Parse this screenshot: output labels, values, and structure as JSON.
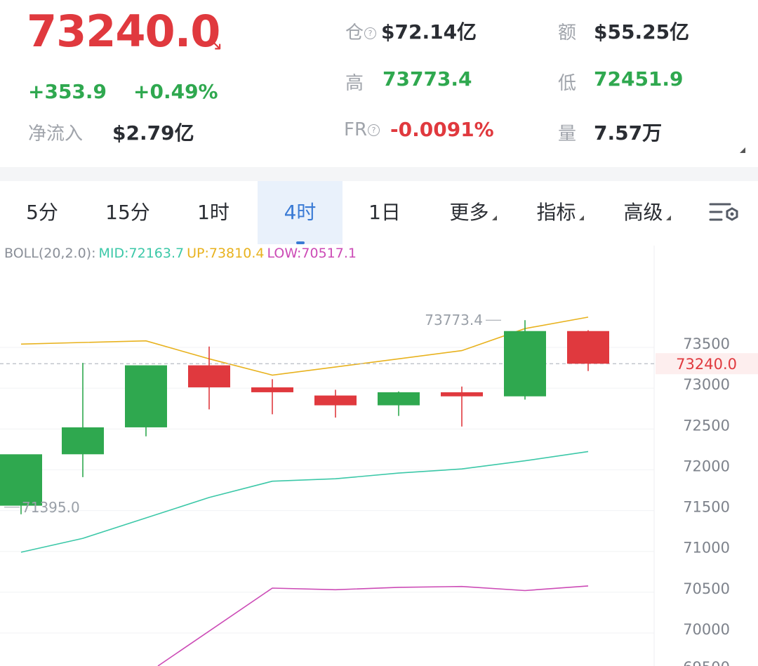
{
  "header": {
    "price": "73240.0",
    "change_abs": "+353.9",
    "change_pct": "+0.49%",
    "netflow_label": "净流入",
    "netflow_value": "$2.79亿",
    "open_interest_label": "仓",
    "open_interest_value": "$72.14亿",
    "turnover_label": "额",
    "turnover_value": "$55.25亿",
    "high_label": "高",
    "high_value": "73773.4",
    "low_label": "低",
    "low_value": "72451.9",
    "funding_label": "FR",
    "funding_value": "-0.0091%",
    "volume_label": "量",
    "volume_value": "7.57万"
  },
  "tabs": [
    {
      "label": "5分",
      "active": false
    },
    {
      "label": "15分",
      "active": false
    },
    {
      "label": "1时",
      "active": false
    },
    {
      "label": "4时",
      "active": true
    },
    {
      "label": "1日",
      "active": false
    },
    {
      "label": "更多",
      "active": false,
      "dropdown": true
    },
    {
      "label": "指标",
      "active": false,
      "dropdown": true
    },
    {
      "label": "高级",
      "active": false,
      "dropdown": true
    }
  ],
  "boll": {
    "label": "BOLL(20,2.0):",
    "mid": "MID:72163.7",
    "up": "UP:73810.4",
    "low": "LOW:70517.1"
  },
  "colors": {
    "up": "#2fa84f",
    "down": "#e0393e",
    "boll_mid": "#3cc8a8",
    "boll_up": "#e8b21e",
    "boll_low": "#cc4bb6",
    "active_tab": "#3a7bd5"
  },
  "chart_data": {
    "type": "candlestick",
    "y_ticks": [
      "73500",
      "73000",
      "72500",
      "72000",
      "71500",
      "71000",
      "70500",
      "70000"
    ],
    "ylim": [
      69900,
      74500
    ],
    "current_price_label": "73240.0",
    "high_marker": "73773.4",
    "low_marker": "71395.0",
    "candles": [
      {
        "open": 71500,
        "high": 71500,
        "low": 71395,
        "close": 72130
      },
      {
        "open": 72130,
        "high": 73250,
        "low": 71850,
        "close": 72460
      },
      {
        "open": 72460,
        "high": 73220,
        "low": 72350,
        "close": 73220
      },
      {
        "open": 73220,
        "high": 73450,
        "low": 72680,
        "close": 72950
      },
      {
        "open": 72950,
        "high": 73050,
        "low": 72620,
        "close": 72890
      },
      {
        "open": 72850,
        "high": 72920,
        "low": 72580,
        "close": 72730
      },
      {
        "open": 72730,
        "high": 72900,
        "low": 72600,
        "close": 72890
      },
      {
        "open": 72890,
        "high": 72960,
        "low": 72470,
        "close": 72840
      },
      {
        "open": 72840,
        "high": 73773.4,
        "low": 72800,
        "close": 73640
      },
      {
        "open": 73640,
        "high": 73650,
        "low": 73150,
        "close": 73240
      }
    ],
    "boll_up_series": [
      73480,
      73500,
      73520,
      73300,
      73100,
      73200,
      73300,
      73400,
      73670,
      73810.4
    ],
    "boll_mid_series": [
      70930,
      71100,
      71350,
      71600,
      71800,
      71830,
      71900,
      71950,
      72050,
      72163.7
    ],
    "boll_low_series": [
      null,
      null,
      null,
      69900,
      70490,
      70470,
      70500,
      70510,
      70460,
      70517.1
    ]
  }
}
